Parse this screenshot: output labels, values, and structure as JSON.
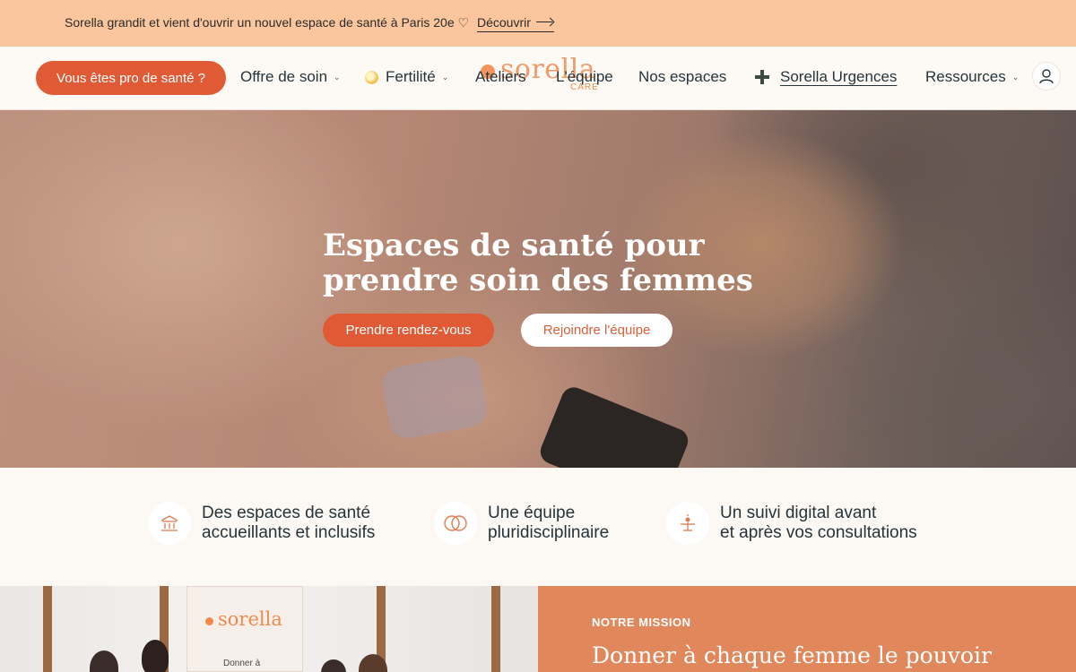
{
  "announcement": {
    "text": "Sorella grandit et vient d'ouvrir un nouvel espace de santé à Paris 20e ♡",
    "link_label": "Découvrir"
  },
  "nav": {
    "pro_button": "Vous êtes pro de santé ?",
    "items": [
      {
        "label": "Offre de soin",
        "has_dropdown": true
      },
      {
        "label": "Fertilité",
        "has_dropdown": true
      },
      {
        "label": "Ateliers"
      },
      {
        "label": "L'équipe"
      },
      {
        "label": "Nos espaces"
      },
      {
        "label": "Sorella Urgences"
      },
      {
        "label": "Ressources",
        "has_dropdown": true
      }
    ],
    "logo_word": "sorella",
    "logo_sub": "CARE",
    "chevron_glyph": "⌄",
    "user_icon": "user-icon"
  },
  "hero": {
    "title": "Espaces de santé pour prendre soin des femmes",
    "primary_button": "Prendre rendez-vous",
    "secondary_button": "Rejoindre l'équipe"
  },
  "features": [
    {
      "icon": "building-icon",
      "line1": "Des espaces de santé",
      "line2": "accueillants et inclusifs"
    },
    {
      "icon": "rings-icon",
      "line1": "Une équipe",
      "line2": "pluridisciplinaire"
    },
    {
      "icon": "sparkle-person-icon",
      "line1": "Un suivi digital avant",
      "line2": "et après vos consultations"
    }
  ],
  "photo_banner": {
    "word": "sorella",
    "small": "Donner à"
  },
  "mission": {
    "kicker": "NOTRE MISSION",
    "title": "Donner à chaque femme le pouvoir"
  },
  "colors": {
    "announcement_bg": "#fbc59d",
    "accent": "#e05a35",
    "logo": "#ef8a4f",
    "mission_bg": "#e0885c",
    "page_bg": "#fcf8f4"
  }
}
